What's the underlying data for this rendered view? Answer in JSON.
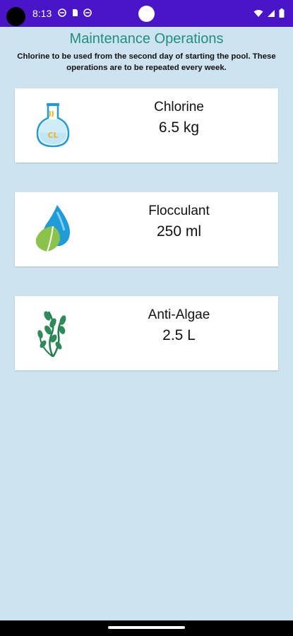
{
  "status_bar": {
    "time": "8:13",
    "left_icons": [
      "no-disturb-icon",
      "sim-card-icon",
      "no-disturb-icon"
    ],
    "right_icons": [
      "wifi-icon",
      "signal-icon",
      "battery-icon"
    ]
  },
  "header": {
    "title": "Maintenance Operations",
    "subtitle": "Chlorine to be used from the second day of starting the pool. These operations are to be repeated every week."
  },
  "items": [
    {
      "name": "Chlorine",
      "amount": "6.5 kg",
      "icon": "chlorine-flask-icon",
      "icon_text": "CL"
    },
    {
      "name": "Flocculant",
      "amount": "250 ml",
      "icon": "water-drop-leaf-icon"
    },
    {
      "name": "Anti-Algae",
      "amount": "2.5 L",
      "icon": "seaweed-icon"
    }
  ],
  "colors": {
    "status_bar": "#4a14c8",
    "background": "#cde3ef",
    "title": "#1f8f83",
    "card": "#ffffff"
  }
}
